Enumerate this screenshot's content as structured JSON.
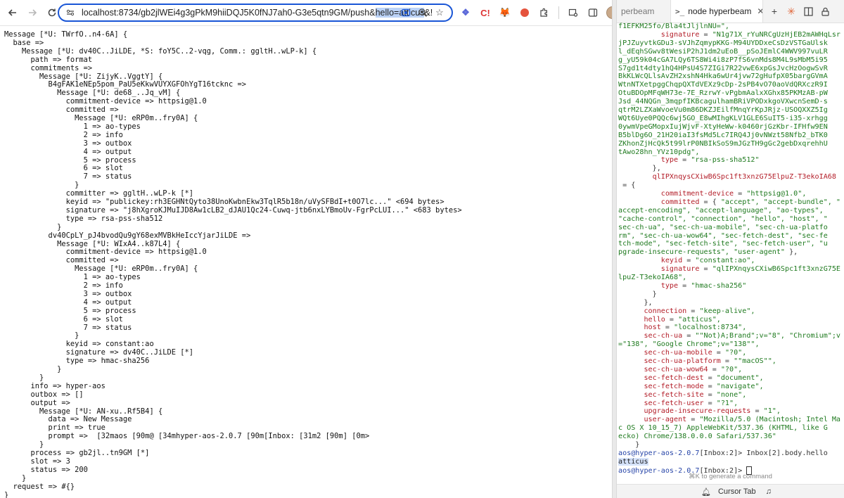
{
  "browser": {
    "back_icon": "arrow-left-icon",
    "forward_icon": "arrow-right-icon",
    "reload_icon": "reload-icon",
    "url_before": "localhost:8734/gb2jlWEi4g3gPkM9hiiDQJ5K0fNJ7ah0-G3e5qtn9GM/push&",
    "url_highlight": "hello=atticus",
    "url_after": "&!",
    "content_lines": [
      "Message [*U: TWrfO..n4-6A] {",
      "  base =>",
      "    Message [*U: dv40C..JiLDE, *S: foY5C..2-vqg, Comm.: ggltH..wLP-k] {",
      "      path => format",
      "      commitments =>",
      "        Message [*U: ZijyK..VggtY] {",
      "          B4gFAK1eNEp5pom_PaU5eKkwVUYXGFOhYgT16tcknc =>",
      "            Message [*U: de68_..Jq_vM] {",
      "              commitment-device => httpsig@1.0",
      "              committed =>",
      "                Message [*U: eRP0m..fry0A] {",
      "                  1 => ao-types",
      "                  2 => info",
      "                  3 => outbox",
      "                  4 => output",
      "                  5 => process",
      "                  6 => slot",
      "                  7 => status",
      "                }",
      "              committer => ggltH..wLP-k [*]",
      "              keyid => \"publickey:rh3EGHNtQyto38UnoKwbnEkw3TqlR5b18n/uVySFBdI+t0O7lc...\" <694 bytes>",
      "              signature => \"j8hXgroKJMuIJD8Aw1cLB2_dJAU1Qc24-Cuwq-jtb6nxLYBmoUv-FgrPcLUI...\" <683 bytes>",
      "              type => rsa-pss-sha512",
      "            }",
      "          dv40CpLY_pJ4bvodQu9gY68exMVBkHeIccYjarJiLDE =>",
      "            Message [*U: WIxA4..k87L4] {",
      "              commitment-device => httpsig@1.0",
      "              committed =>",
      "                Message [*U: eRP0m..fry0A] {",
      "                  1 => ao-types",
      "                  2 => info",
      "                  3 => outbox",
      "                  4 => output",
      "                  5 => process",
      "                  6 => slot",
      "                  7 => status",
      "                }",
      "              keyid => constant:ao",
      "              signature => dv40C..JiLDE [*]",
      "              type => hmac-sha256",
      "            }",
      "        }",
      "      info => hyper-aos",
      "      outbox => []",
      "      output =>",
      "        Message [*U: AN-xu..Rf5B4] {",
      "          data => New Message",
      "          print => true",
      "          prompt =>  [32maos [90m@ [34mhyper-aos-2.0.7 [90m[Inbox: [31m2 [90m] [0m>",
      "        }",
      "      process => gb2jl..tn9GM [*]",
      "      slot => 3",
      "      status => 200",
      "    }",
      "  request => #{}",
      "}"
    ]
  },
  "editor": {
    "tab_prev_label": "perbeam",
    "tab_active_label": "node hyperbeam",
    "status_hint": "⌘K to generate a command",
    "status_cursor_tab": "Cursor Tab",
    "terminal_lines": [
      [
        [
          "s",
          "f1EFKM25fo/Bla4tJljlnNU=\","
        ]
      ],
      [
        [
          "p",
          "          signature"
        ],
        [
          "n",
          " = "
        ],
        [
          "s",
          "\"N1g71X_rYuNRCgUzHjEB2mAWHqLsr"
        ]
      ],
      [
        [
          "s",
          "jPJZuyvtkGDu3-sVJhZqmypKKG-M94UYDDxeCsDzVSTGaUlsk"
        ]
      ],
      [
        [
          "s",
          "l_dEqhSGwv8tWesiP2hJ1dm2uEoB__pSoJEmlC4WWV997vuLR"
        ]
      ],
      [
        [
          "s",
          "g_yU59k04cGA7LQy6TS8Wi4i8zP7fS6vnMds8M4L9sMbM5i95"
        ]
      ],
      [
        [
          "s",
          "S7gd1t4dty1hQ4HPsU4S7ZIGi7R22vwE6xpGsJvcHzOogwSvR"
        ]
      ],
      [
        [
          "s",
          "BkKLWcQLlsAvZH2xshN4Hka6wUr4jvw72gHufpX05bargGVmA"
        ]
      ],
      [
        [
          "s",
          "WtnNTXetpggChqpQXTdVEXz9cDp-2sPB4vO70aoVdQRXczR9I"
        ]
      ],
      [
        [
          "s",
          "OtuBDOpMFqWH73e-7E_RzrwY-vPgbmAalxXGhx85PKMzAB-pW"
        ]
      ],
      [
        [
          "s",
          "Jsd_44NQGn_3mqpfIKBcagulhamBRiVPODxkgoVXwcnSemD-s"
        ]
      ],
      [
        [
          "s",
          "qtrM2LZXaWvoeVu0m86DKZJEilfMnqYrKpJRjz-USOQXXZ5Ig"
        ]
      ],
      [
        [
          "s",
          "WQt6Uye0PQQc6wj5GO_E8wMIhgKLV1GLE6SuIT5-i35-xrhgg"
        ]
      ],
      [
        [
          "s",
          "0ywmVpeGMopxIujWjvF-XtyHeWw-k0460rjGzKbr-IFHfw9EN"
        ]
      ],
      [
        [
          "s",
          "B5blDg6O_21H20iaI3fsMd5Lc7IRQ4Jj0vNWzt58Nfb2_bTK0"
        ]
      ],
      [
        [
          "s",
          "ZKhonZjHcQk5t99lrP0NBIkSoS9mJGzTH9gGc2gebDxqrehhU"
        ]
      ],
      [
        [
          "s",
          "tAwo28hn_YVz10pdg\","
        ]
      ],
      [
        [
          "p",
          "          type"
        ],
        [
          "n",
          " = "
        ],
        [
          "s",
          "\"rsa-pss-sha512\""
        ]
      ],
      [
        [
          "n",
          "        },"
        ]
      ],
      [
        [
          "p",
          "        qlIPXnqysCXiwB6Spc1ft3xnzG75ElpuZ-T3ekoIA68"
        ]
      ],
      [
        [
          "n",
          " = {"
        ]
      ],
      [
        [
          "p",
          "          commitment-device"
        ],
        [
          "n",
          " = "
        ],
        [
          "s",
          "\"httpsig@1.0\","
        ]
      ],
      [
        [
          "p",
          "          committed"
        ],
        [
          "n",
          " = { "
        ],
        [
          "s",
          "\"accept\", \"accept-bundle\", \""
        ]
      ],
      [
        [
          "s",
          "accept-encoding\", \"accept-language\", \"ao-types\","
        ]
      ],
      [
        [
          "s",
          "\"cache-control\", \"connection\", \"hello\", \"host\", \""
        ]
      ],
      [
        [
          "s",
          "sec-ch-ua\", \"sec-ch-ua-mobile\", \"sec-ch-ua-platfo"
        ]
      ],
      [
        [
          "s",
          "rm\", \"sec-ch-ua-wow64\", \"sec-fetch-dest\", \"sec-fe"
        ]
      ],
      [
        [
          "s",
          "tch-mode\", \"sec-fetch-site\", \"sec-fetch-user\", \"u"
        ]
      ],
      [
        [
          "s",
          "pgrade-insecure-requests\", \"user-agent\""
        ],
        [
          "n",
          " },"
        ]
      ],
      [
        [
          "p",
          "          keyid"
        ],
        [
          "n",
          " = "
        ],
        [
          "s",
          "\"constant:ao\","
        ]
      ],
      [
        [
          "p",
          "          signature"
        ],
        [
          "n",
          " = "
        ],
        [
          "s",
          "\"qlIPXnqysCXiwB6Spc1ft3xnzG75E"
        ]
      ],
      [
        [
          "s",
          "lpuZ-T3ekoIA68\","
        ]
      ],
      [
        [
          "p",
          "          type"
        ],
        [
          "n",
          " = "
        ],
        [
          "s",
          "\"hmac-sha256\""
        ]
      ],
      [
        [
          "n",
          "        }"
        ]
      ],
      [
        [
          "n",
          "      },"
        ]
      ],
      [
        [
          "p",
          "      connection"
        ],
        [
          "n",
          " = "
        ],
        [
          "s",
          "\"keep-alive\","
        ]
      ],
      [
        [
          "p",
          "      hello"
        ],
        [
          "n",
          " = "
        ],
        [
          "s",
          "\"atticus\","
        ]
      ],
      [
        [
          "p",
          "      host"
        ],
        [
          "n",
          " = "
        ],
        [
          "s",
          "\"localhost:8734\","
        ]
      ],
      [
        [
          "p",
          "      sec-ch-ua"
        ],
        [
          "n",
          " = "
        ],
        [
          "s",
          "\"\"Not)A;Brand\";v=\"8\", \"Chromium\";v"
        ]
      ],
      [
        [
          "s",
          "=\"138\", \"Google Chrome\";v=\"138\"\","
        ]
      ],
      [
        [
          "p",
          "      sec-ch-ua-mobile"
        ],
        [
          "n",
          " = "
        ],
        [
          "s",
          "\"?0\","
        ]
      ],
      [
        [
          "p",
          "      sec-ch-ua-platform"
        ],
        [
          "n",
          " = "
        ],
        [
          "s",
          "\"\"macOS\"\","
        ]
      ],
      [
        [
          "p",
          "      sec-ch-ua-wow64"
        ],
        [
          "n",
          " = "
        ],
        [
          "s",
          "\"?0\","
        ]
      ],
      [
        [
          "p",
          "      sec-fetch-dest"
        ],
        [
          "n",
          " = "
        ],
        [
          "s",
          "\"document\","
        ]
      ],
      [
        [
          "p",
          "      sec-fetch-mode"
        ],
        [
          "n",
          " = "
        ],
        [
          "s",
          "\"navigate\","
        ]
      ],
      [
        [
          "p",
          "      sec-fetch-site"
        ],
        [
          "n",
          " = "
        ],
        [
          "s",
          "\"none\","
        ]
      ],
      [
        [
          "p",
          "      sec-fetch-user"
        ],
        [
          "n",
          " = "
        ],
        [
          "s",
          "\"?1\","
        ]
      ],
      [
        [
          "p",
          "      upgrade-insecure-requests"
        ],
        [
          "n",
          " = "
        ],
        [
          "s",
          "\"1\","
        ]
      ],
      [
        [
          "p",
          "      user-agent"
        ],
        [
          "n",
          " = "
        ],
        [
          "s",
          "\"Mozilla/5.0 (Macintosh; Intel Ma"
        ]
      ],
      [
        [
          "s",
          "c OS X 10_15_7) AppleWebKit/537.36 (KHTML, like G"
        ]
      ],
      [
        [
          "s",
          "ecko) Chrome/138.0.0.0 Safari/537.36\""
        ]
      ],
      [
        [
          "n",
          "    }"
        ]
      ],
      [
        [
          "q",
          "aos@hyper-aos-2.0.7"
        ],
        [
          "n",
          "[Inbox:2]> Inbox[2].body.hello"
        ]
      ],
      [
        [
          "h",
          "atticus"
        ]
      ],
      [
        [
          "q",
          "aos@hyper-aos-2.0.7"
        ],
        [
          "n",
          "[Inbox:2]> "
        ],
        [
          "c",
          ""
        ]
      ]
    ]
  }
}
